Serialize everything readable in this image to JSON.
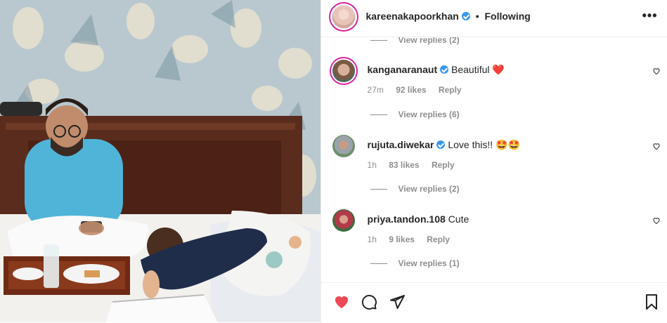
{
  "post": {
    "username": "kareenakapoorkhan",
    "separator": "•",
    "follow_status": "Following",
    "more_label": "•••"
  },
  "comments": [
    {
      "username": "kanganaranaut",
      "text": "Beautiful",
      "emoji": "❤️",
      "time": "27m",
      "likes": "92 likes",
      "reply": "Reply",
      "view_replies": "View replies (6)"
    },
    {
      "username": "rujuta.diwekar",
      "text": "Love this!!",
      "emoji": "🤩🤩",
      "time": "1h",
      "likes": "83 likes",
      "reply": "Reply",
      "view_replies": "View replies (2)"
    },
    {
      "username": "priya.tandon.108",
      "text": "Cute",
      "emoji": "",
      "time": "1h",
      "likes": "9 likes",
      "reply": "Reply",
      "view_replies": "View replies (1)"
    }
  ],
  "top_view_replies": "View replies (2)",
  "colors": {
    "like_red": "#ed4956",
    "verified_blue": "#3897f0",
    "muted": "#8e8e8e"
  }
}
